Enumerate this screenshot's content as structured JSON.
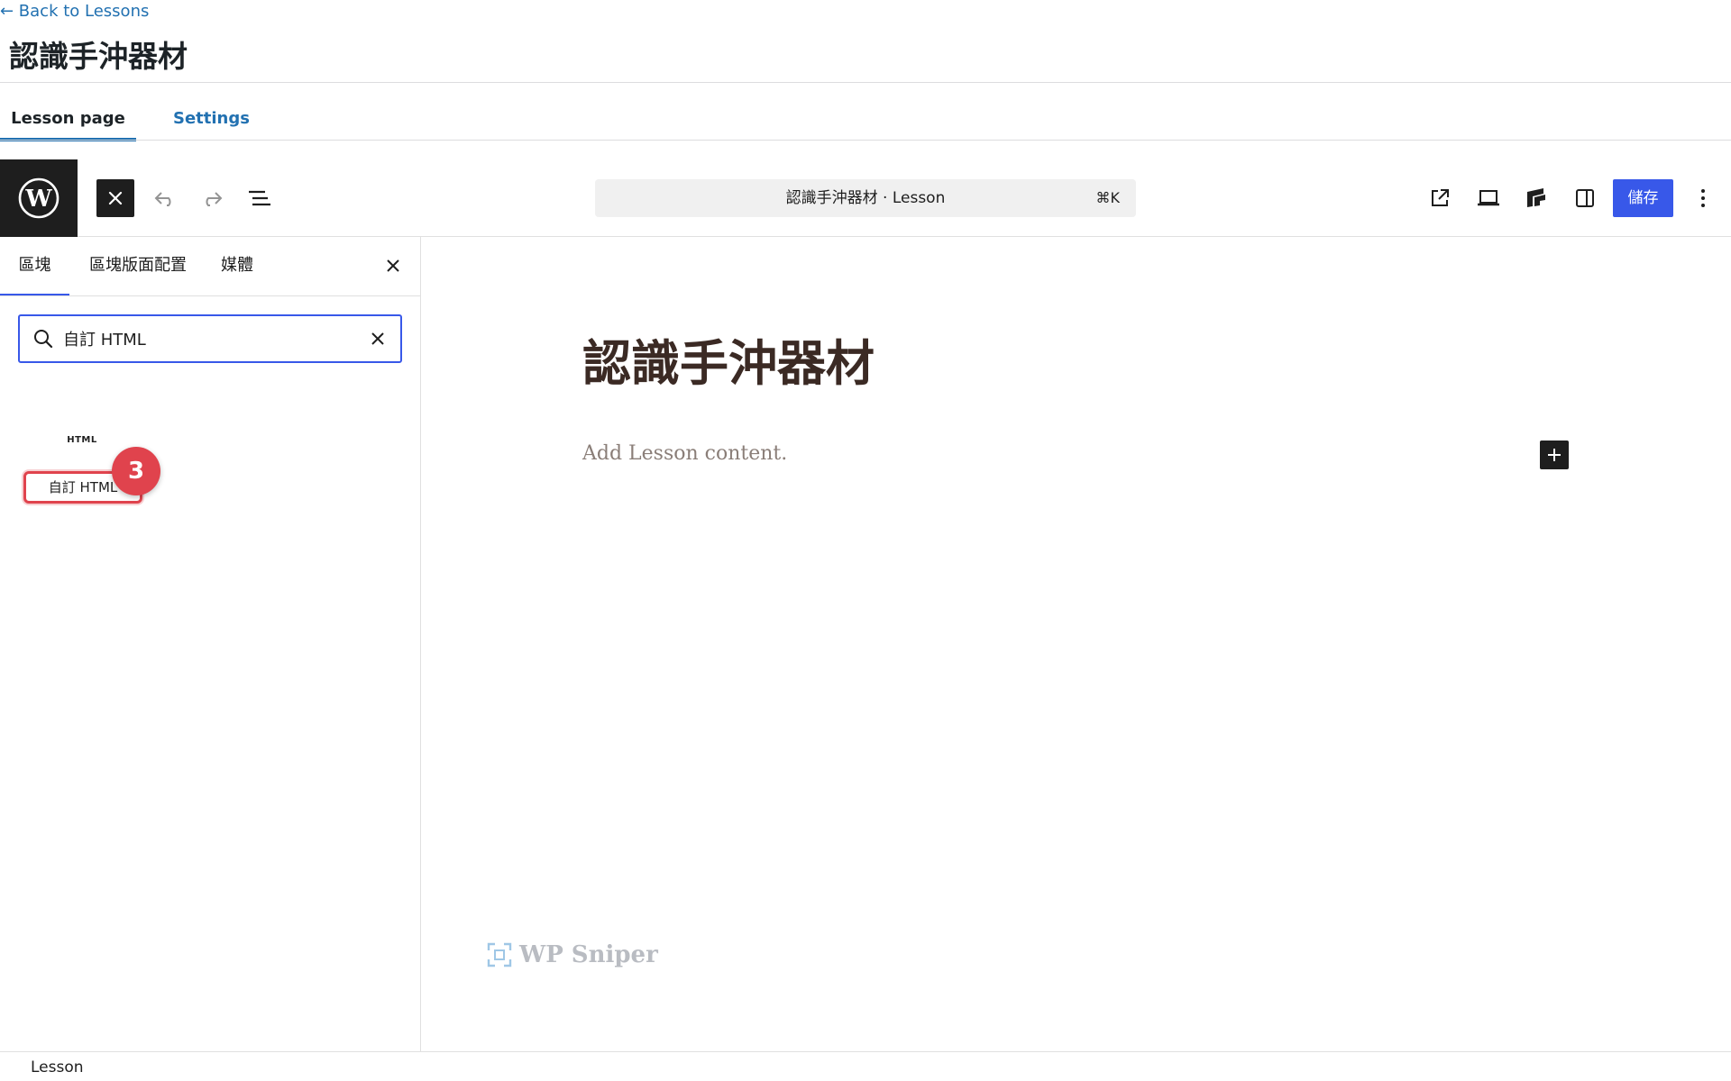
{
  "header": {
    "back_link": "← Back to Lessons",
    "title": "認識手沖器材"
  },
  "tabs": [
    {
      "label": "Lesson page",
      "active": true
    },
    {
      "label": "Settings",
      "active": false
    }
  ],
  "toolbar": {
    "command_bar_title": "認識手沖器材 · Lesson",
    "command_bar_shortcut": "⌘K",
    "save_label": "儲存",
    "accent_color": "#3858e9"
  },
  "inserter": {
    "tabs": [
      {
        "label": "區塊",
        "active": true
      },
      {
        "label": "區塊版面配置",
        "active": false
      },
      {
        "label": "媒體",
        "active": false
      }
    ],
    "search_value": "自訂 HTML",
    "results": [
      {
        "icon_text": "HTML",
        "label": "自訂 HTML"
      }
    ],
    "step_badge": "3",
    "highlight_color": "#e0434d"
  },
  "canvas": {
    "post_title": "認識手沖器材",
    "content_placeholder": "Add Lesson content.",
    "watermark": "WP Sniper"
  },
  "footer": {
    "breadcrumb": "Lesson"
  }
}
